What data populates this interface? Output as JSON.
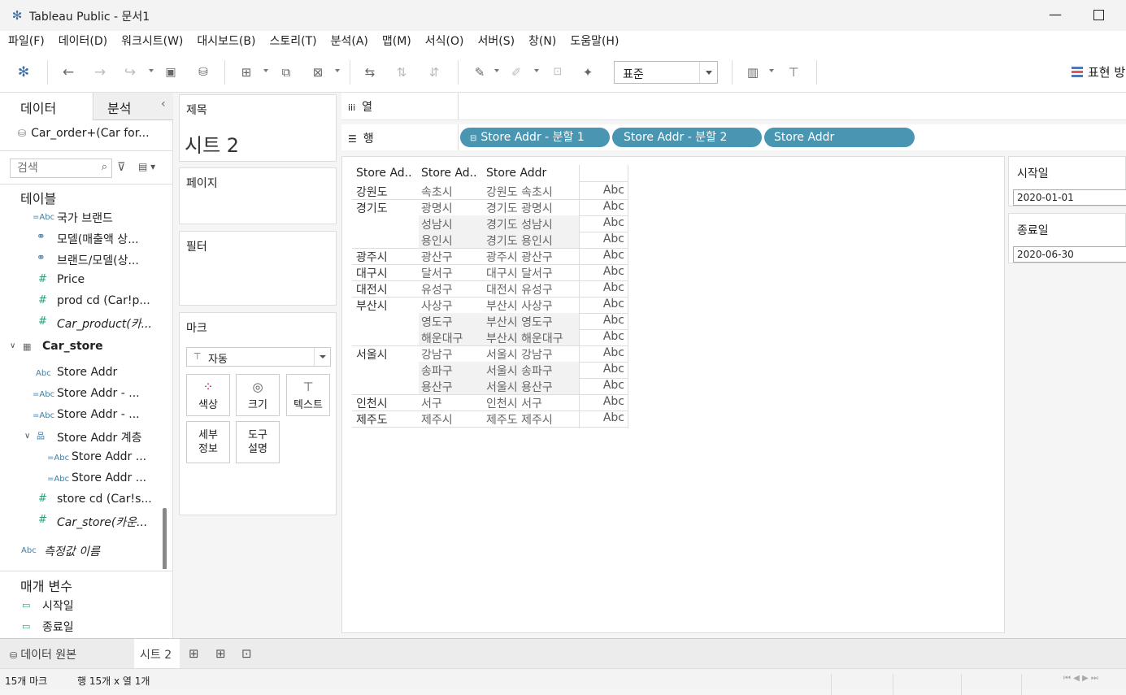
{
  "window": {
    "title": "Tableau Public - 문서1"
  },
  "menu": [
    "파일(F)",
    "데이터(D)",
    "워크시트(W)",
    "대시보드(B)",
    "스토리(T)",
    "분석(A)",
    "맵(M)",
    "서식(O)",
    "서버(S)",
    "창(N)",
    "도움말(H)"
  ],
  "toolbar": {
    "fit_select": "표준",
    "show_me": "표현 방"
  },
  "left": {
    "tab_data": "데이터",
    "tab_analysis": "분석",
    "datasource": "Car_order+(Car for...",
    "search_placeholder": "검색",
    "tables_header": "테이블",
    "fields1": [
      {
        "icon": "=Abc",
        "label": "국가 브랜드"
      },
      {
        "icon": "⚭",
        "label": "모델(매출액 상..."
      },
      {
        "icon": "⚭",
        "label": "브랜드/모델(상..."
      },
      {
        "icon": "#",
        "label": "Price"
      },
      {
        "icon": "#",
        "label": "prod cd (Car!p..."
      },
      {
        "icon": "#",
        "label": "Car_product(카..."
      }
    ],
    "table2": "Car_store",
    "fields2": [
      {
        "icon": "Abc",
        "label": "Store Addr"
      },
      {
        "icon": "=Abc",
        "label": "Store Addr - ..."
      },
      {
        "icon": "=Abc",
        "label": "Store Addr - ..."
      },
      {
        "icon": "品",
        "label": "Store Addr 계층"
      },
      {
        "icon": "=Abc",
        "label": "Store Addr ..."
      },
      {
        "icon": "=Abc",
        "label": "Store Addr ..."
      },
      {
        "icon": "#",
        "label": "store cd (Car!s..."
      },
      {
        "icon": "#",
        "label": "Car_store(카운..."
      }
    ],
    "measure_names": "측정값 이름",
    "measure_icon": "Abc",
    "params_header": "매개 변수",
    "params": [
      "시작일",
      "종료일"
    ]
  },
  "shelves": {
    "title_label": "제목",
    "sheet_title": "시트 2",
    "pages": "페이지",
    "filters": "필터",
    "marks": "마크",
    "mark_type": "자동",
    "mark_buttons": {
      "color": "색상",
      "size": "크기",
      "text": "텍스트",
      "detail": "세부\n정보",
      "tooltip": "도구\n설명"
    }
  },
  "columns_label": "열",
  "rows_label": "행",
  "row_pills": [
    "Store Addr - 분할 1",
    "Store Addr - 분할 2",
    "Store Addr"
  ],
  "table": {
    "headers": [
      "Store Ad..",
      "Store Ad..",
      "Store Addr"
    ],
    "groups": [
      {
        "region": "강원도",
        "rows": [
          [
            "속초시",
            "강원도 속초시"
          ]
        ]
      },
      {
        "region": "경기도",
        "rows": [
          [
            "광명시",
            "경기도 광명시"
          ],
          [
            "성남시",
            "경기도 성남시"
          ],
          [
            "용인시",
            "경기도 용인시"
          ]
        ]
      },
      {
        "region": "광주시",
        "rows": [
          [
            "광산구",
            "광주시 광산구"
          ]
        ]
      },
      {
        "region": "대구시",
        "rows": [
          [
            "달서구",
            "대구시 달서구"
          ]
        ]
      },
      {
        "region": "대전시",
        "rows": [
          [
            "유성구",
            "대전시 유성구"
          ]
        ]
      },
      {
        "region": "부산시",
        "rows": [
          [
            "사상구",
            "부산시 사상구"
          ],
          [
            "영도구",
            "부산시 영도구"
          ],
          [
            "해운대구",
            "부산시 해운대구"
          ]
        ]
      },
      {
        "region": "서울시",
        "rows": [
          [
            "강남구",
            "서울시 강남구"
          ],
          [
            "송파구",
            "서울시 송파구"
          ],
          [
            "용산구",
            "서울시 용산구"
          ]
        ]
      },
      {
        "region": "인천시",
        "rows": [
          [
            "서구",
            "인천시 서구"
          ]
        ]
      },
      {
        "region": "제주도",
        "rows": [
          [
            "제주시",
            "제주도 제주시"
          ]
        ]
      }
    ],
    "cell_value": "Abc"
  },
  "params_panel": {
    "start_label": "시작일",
    "start_value": "2020-01-01",
    "end_label": "종료일",
    "end_value": "2020-06-30"
  },
  "bottom": {
    "datasource_tab": "데이터 원본",
    "sheet_tab": "시트 2"
  },
  "status": {
    "marks": "15개 마크",
    "rows_cols": "행 15개  x  열 1개"
  }
}
